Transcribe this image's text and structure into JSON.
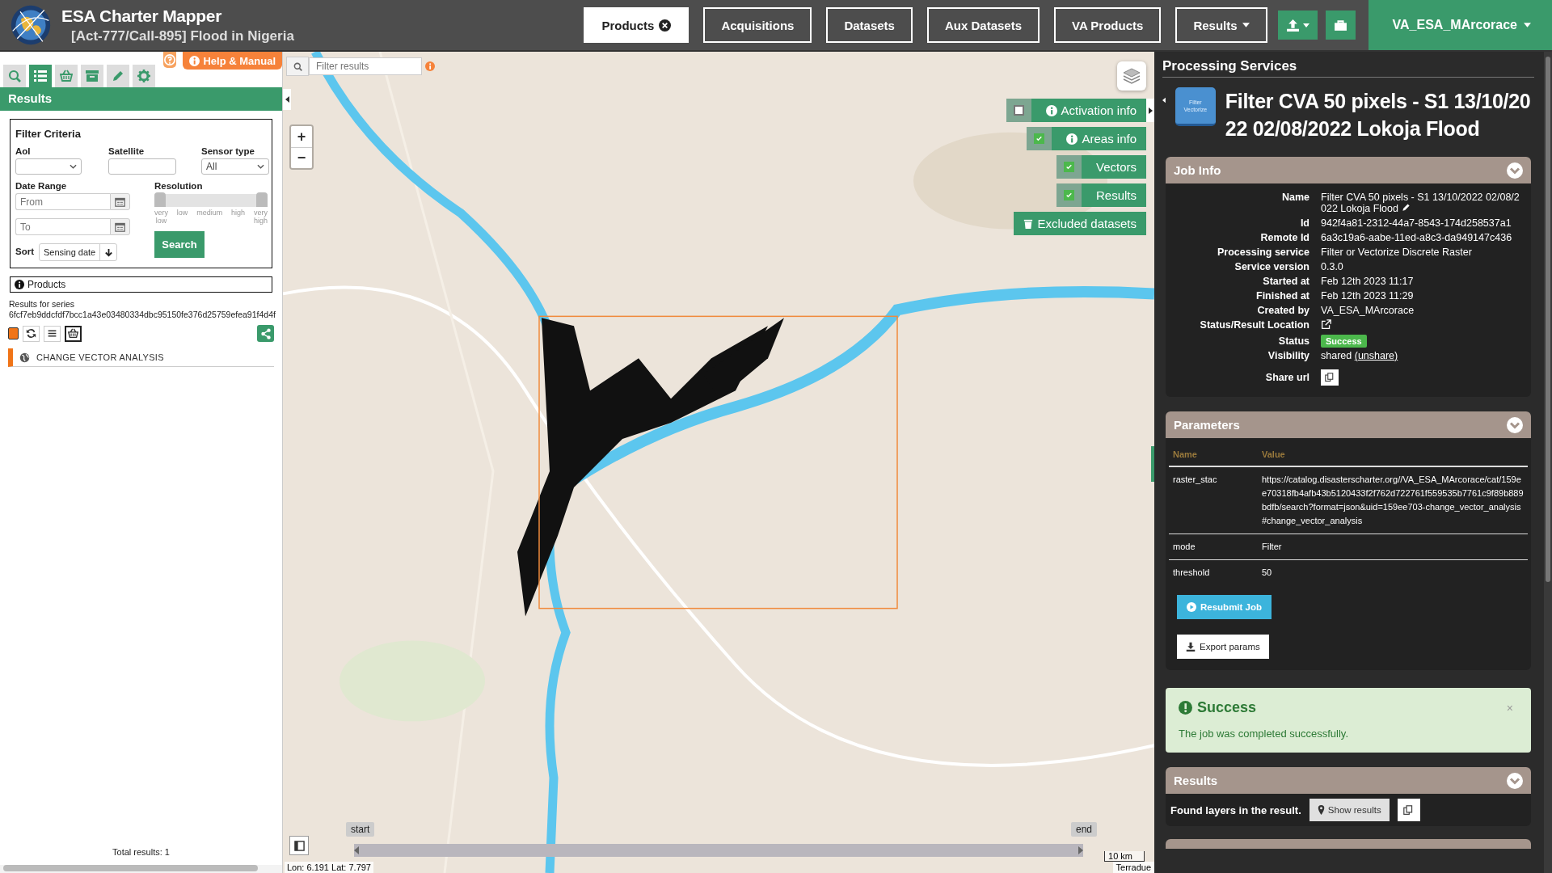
{
  "header": {
    "title": "ESA Charter Mapper",
    "subtitle": "[Act-777/Call-895] Flood in Nigeria",
    "nav": [
      {
        "label": "Products",
        "selected": true,
        "dropdown": false
      },
      {
        "label": "Acquisitions",
        "selected": false,
        "dropdown": false
      },
      {
        "label": "Datasets",
        "selected": false,
        "dropdown": false
      },
      {
        "label": "Aux Datasets",
        "selected": false,
        "dropdown": false
      },
      {
        "label": "VA Products",
        "selected": false,
        "dropdown": false
      },
      {
        "label": "Results",
        "selected": false,
        "dropdown": true
      }
    ],
    "user": "VA_ESA_MArcorace"
  },
  "left_panel": {
    "tabs": [
      {
        "selected": false
      },
      {
        "selected": true
      },
      {
        "selected": false
      },
      {
        "selected": false
      },
      {
        "selected": false
      },
      {
        "selected": false
      }
    ],
    "help_button": "Help & Manual",
    "title": "Results",
    "filter": {
      "title": "Filter Criteria",
      "aoi_label": "AoI",
      "satellite_label": "Satellite",
      "sensor_label": "Sensor type",
      "sensor_value": "All",
      "date_label": "Date Range",
      "from_placeholder": "From",
      "to_placeholder": "To",
      "resolution_label": "Resolution",
      "resolution_thumbs": [
        {
          "level": 0
        },
        {
          "level": 1
        }
      ],
      "resolution_ticks": [
        "very low",
        "low",
        "medium",
        "high",
        "very high"
      ],
      "search_button": "Search",
      "sort_label": "Sort",
      "sort_value": "Sensing date"
    },
    "products": {
      "title": "Products",
      "series_label": "Results for series",
      "series_id": "6fcf7eb9ddcfdf7bcc1a43e03480334dbc95150fe376d25759efea91f4d4f",
      "items": [
        {
          "label": "CHANGE VECTOR ANALYSIS"
        }
      ],
      "total": "Total results: 1"
    }
  },
  "map": {
    "filter_placeholder": "Filter results",
    "zoom_in": "+",
    "zoom_out": "−",
    "layers": [
      {
        "label": "Activation info",
        "checked": false,
        "info": true
      },
      {
        "label": "Areas info",
        "checked": true,
        "info": true
      },
      {
        "label": "Vectors",
        "checked": true,
        "info": false
      },
      {
        "label": "Results",
        "checked": true,
        "info": false
      }
    ],
    "excluded_button": "Excluded datasets",
    "timeline": {
      "start": "start",
      "end": "end"
    },
    "scale": "10 km",
    "coords": "Lon: 6.191 Lat: 7.797",
    "attribution": "Terradue"
  },
  "right_panel": {
    "title": "Processing Services",
    "service_badge": "Filter Vectorize",
    "job_title": "Filter CVA 50 pixels - S1 13/10/2022 02/08/2022 Lokoja Flood",
    "job_info": {
      "title": "Job Info",
      "expanded": true,
      "rows": [
        {
          "label": "Name",
          "kind": "editable",
          "value": "Filter CVA 50 pixels - S1 13/10/2022 02/08/2022 Lokoja Flood"
        },
        {
          "label": "Id",
          "kind": "text",
          "value": "942f4a81-2312-44a7-8543-174d258537a1"
        },
        {
          "label": "Remote Id",
          "kind": "text",
          "value": "6a3c19a6-aabe-11ed-a8c3-da949147c436"
        },
        {
          "label": "Processing service",
          "kind": "text",
          "value": "Filter or Vectorize Discrete Raster"
        },
        {
          "label": "Service version",
          "kind": "text",
          "value": "0.3.0"
        },
        {
          "label": "Started at",
          "kind": "text",
          "value": "Feb 12th 2023 11:17"
        },
        {
          "label": "Finished at",
          "kind": "text",
          "value": "Feb 12th 2023 11:29"
        },
        {
          "label": "Created by",
          "kind": "text",
          "value": "VA_ESA_MArcorace"
        },
        {
          "label": "Status/Result Location",
          "kind": "external"
        },
        {
          "label": "Status",
          "kind": "badge",
          "value": "Success"
        },
        {
          "label": "Visibility",
          "kind": "visibility",
          "value": "shared",
          "link": "(unshare)"
        },
        {
          "label": "Share url",
          "kind": "copy"
        }
      ]
    },
    "parameters": {
      "title": "Parameters",
      "expanded": true,
      "columns": [
        "Name",
        "Value"
      ],
      "rows": [
        [
          "raster_stac",
          "https://catalog.disasterscharter.org//VA_ESA_MArcorace/cat/159ee70318fb4afb43b5120433f2f762d722761f559535b7761c9f89b889bdfb/search?format=json&uid=159ee703-change_vector_analysis#change_vector_analysis"
        ],
        [
          "mode",
          "Filter"
        ],
        [
          "threshold",
          "50"
        ]
      ],
      "resubmit_button": "Resubmit Job",
      "export_button": "Export params"
    },
    "alert": {
      "title": "Success",
      "message": "The job was completed successfully.",
      "close": "×"
    },
    "results": {
      "title": "Results",
      "expanded": true,
      "text": "Found layers in the result.",
      "show_button": "Show results"
    }
  }
}
